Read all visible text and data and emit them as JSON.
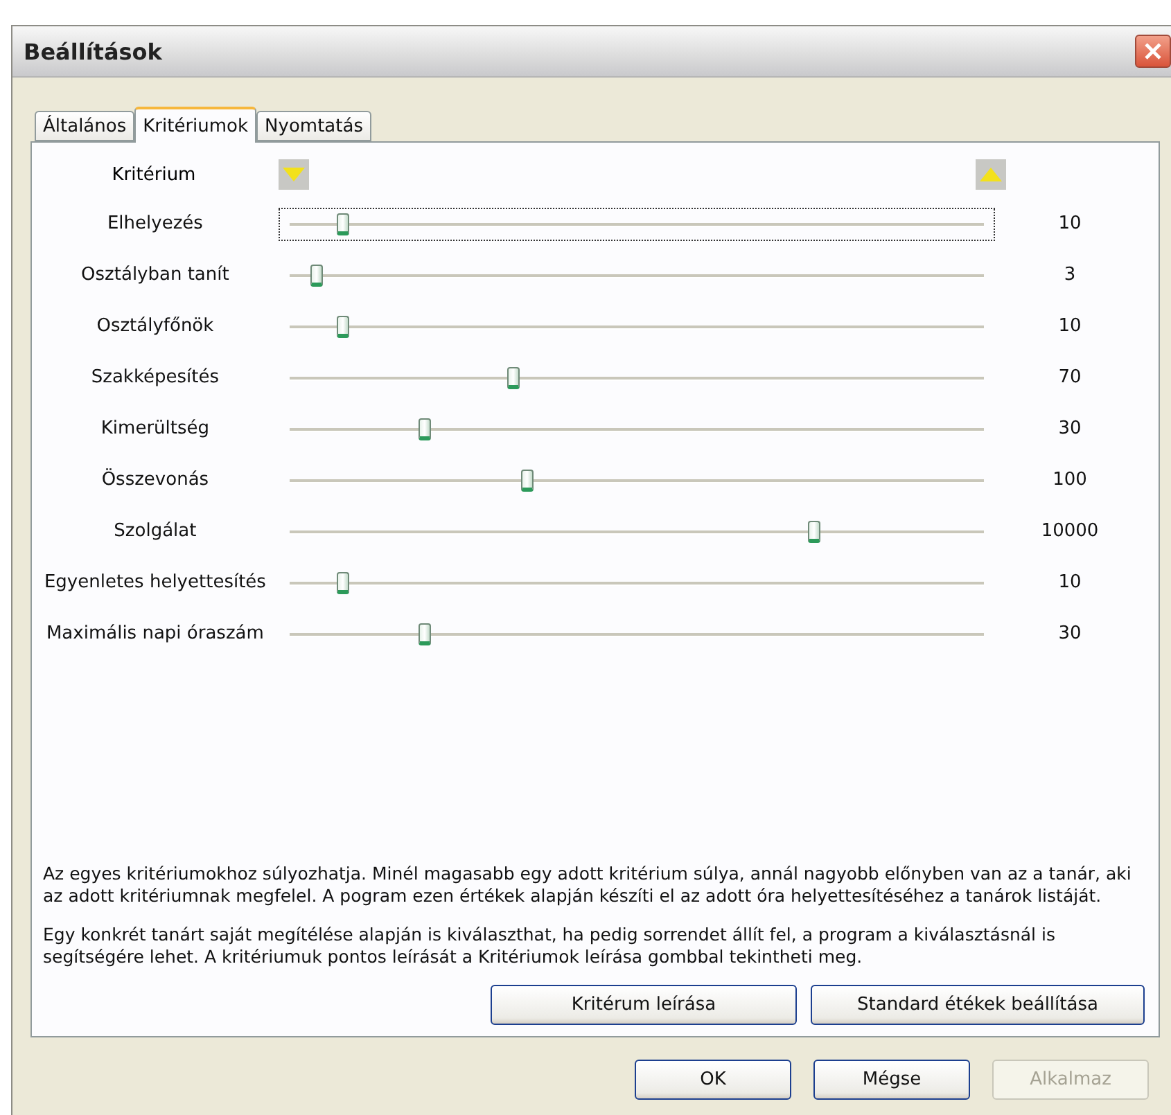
{
  "window": {
    "title": "Beállítások"
  },
  "tabs": [
    {
      "label": "Általános",
      "selected": false
    },
    {
      "label": "Kritériumok",
      "selected": true
    },
    {
      "label": "Nyomtatás",
      "selected": false
    }
  ],
  "header": {
    "label": "Kritérium"
  },
  "criteria": [
    {
      "name": "Elhelyezés",
      "level": 0.07,
      "reading": "10",
      "focused": true
    },
    {
      "name": "Osztályban tanít",
      "level": 0.03,
      "reading": "3",
      "focused": false
    },
    {
      "name": "Osztályfőnök",
      "level": 0.07,
      "reading": "10",
      "focused": false
    },
    {
      "name": "Szakképesítés",
      "level": 0.32,
      "reading": "70",
      "focused": false
    },
    {
      "name": "Kimerültség",
      "level": 0.19,
      "reading": "30",
      "focused": false
    },
    {
      "name": "Összevonás",
      "level": 0.34,
      "reading": "100",
      "focused": false
    },
    {
      "name": "Szolgálat",
      "level": 0.76,
      "reading": "10000",
      "focused": false
    },
    {
      "name": "Egyenletes helyettesítés",
      "level": 0.07,
      "reading": "10",
      "focused": false
    },
    {
      "name": "Maximális napi óraszám",
      "level": 0.19,
      "reading": "30",
      "focused": false
    }
  ],
  "paragraphs": [
    "Az egyes kritériumokhoz súlyozhatja. Minél magasabb egy adott kritérium súlya, annál nagyobb előnyben van az a tanár, aki az adott kritériumnak megfelel. A pogram ezen értékek alapján készíti el az adott óra helyettesítéséhez a tanárok listáját.",
    "Egy konkrét tanárt saját megítélése alapján is kiválaszthat, ha pedig sorrendet állít fel, a program a kiválasztásnál is segítségére lehet. A kritériumuk pontos leírását a Kritériumok leírása gombbal tekintheti meg."
  ],
  "panel_buttons": [
    {
      "label": "Kritérum leírása",
      "disabled": false
    },
    {
      "label": "Standard étékek beállítása",
      "disabled": false
    }
  ],
  "dialog_buttons": [
    {
      "label": "OK",
      "disabled": false
    },
    {
      "label": "Mégse",
      "disabled": false
    },
    {
      "label": "Alkalmaz",
      "disabled": true
    }
  ]
}
